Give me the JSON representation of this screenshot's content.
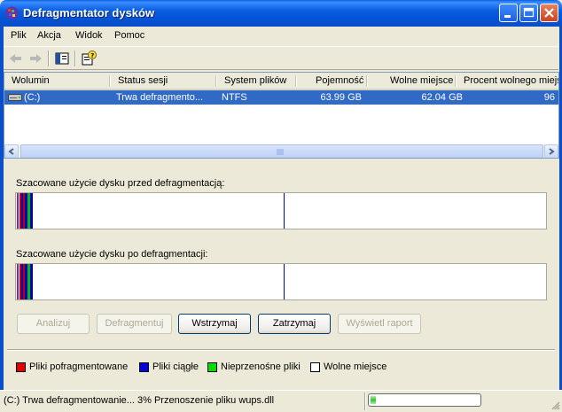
{
  "window": {
    "title": "Defragmentator dysków"
  },
  "menu": [
    "Plik",
    "Akcja",
    "Widok",
    "Pomoc"
  ],
  "list": {
    "columns": [
      "Wolumin",
      "Status sesji",
      "System plików",
      "Pojemność",
      "Wolne miejsce",
      "Procent wolnego miejs"
    ],
    "rows": [
      {
        "volume": "(C:)",
        "status": "Trwa defragmento...",
        "fs": "NTFS",
        "capacity": "63.99 GB",
        "free": "62.04 GB",
        "percent": "96"
      }
    ]
  },
  "analysis": {
    "before_label": "Szacowane użycie dysku przed defragmentacją:",
    "after_label": "Szacowane użycie dysku po defragmentacji:"
  },
  "buttons": {
    "analyze": "Analizuj",
    "defragment": "Defragmentuj",
    "pause": "Wstrzymaj",
    "stop": "Zatrzymaj",
    "report": "Wyświetl raport"
  },
  "legend": [
    {
      "label": "Pliki pofragmentowane",
      "color": "#E00000"
    },
    {
      "label": "Pliki ciągłe",
      "color": "#0000E0"
    },
    {
      "label": "Nieprzenośne pliki",
      "color": "#00E000"
    },
    {
      "label": "Wolne miejsce",
      "color": "#FFFFFF"
    }
  ],
  "status": {
    "text": "(C:) Trwa defragmentowanie...  3%  Przenoszenie pliku wups.dll",
    "progress_percent": 3
  }
}
